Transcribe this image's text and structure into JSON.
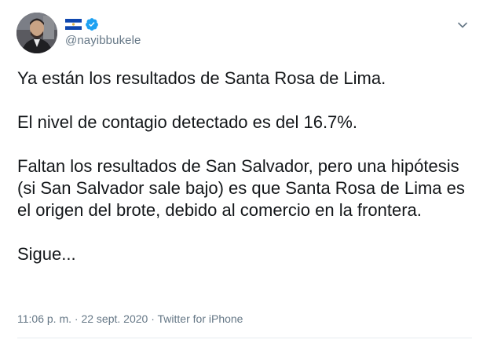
{
  "tweet": {
    "handle": "@nayibbukele",
    "text_lines": [
      "Ya están los resultados de Santa Rosa de Lima.",
      "El nivel de contagio detectado es del 16.7%.",
      "Faltan los resultados de San Salvador, pero una hipótesis (si San Salvador sale bajo) es que Santa Rosa de Lima es el origen del brote, debido al comercio en la frontera.",
      "Sigue..."
    ],
    "time": "11:06 p. m.",
    "separator": "·",
    "date": "22 sept. 2020",
    "source": "Twitter for iPhone"
  },
  "icons": {
    "avatar": "profile-photo",
    "flag": "el-salvador-flag-icon",
    "verified": "verified-badge-icon",
    "caret": "chevron-down-icon"
  },
  "colors": {
    "text": "#14171a",
    "secondary": "#657786",
    "verified_blue": "#1da1f2",
    "flag_blue": "#0f47af"
  }
}
